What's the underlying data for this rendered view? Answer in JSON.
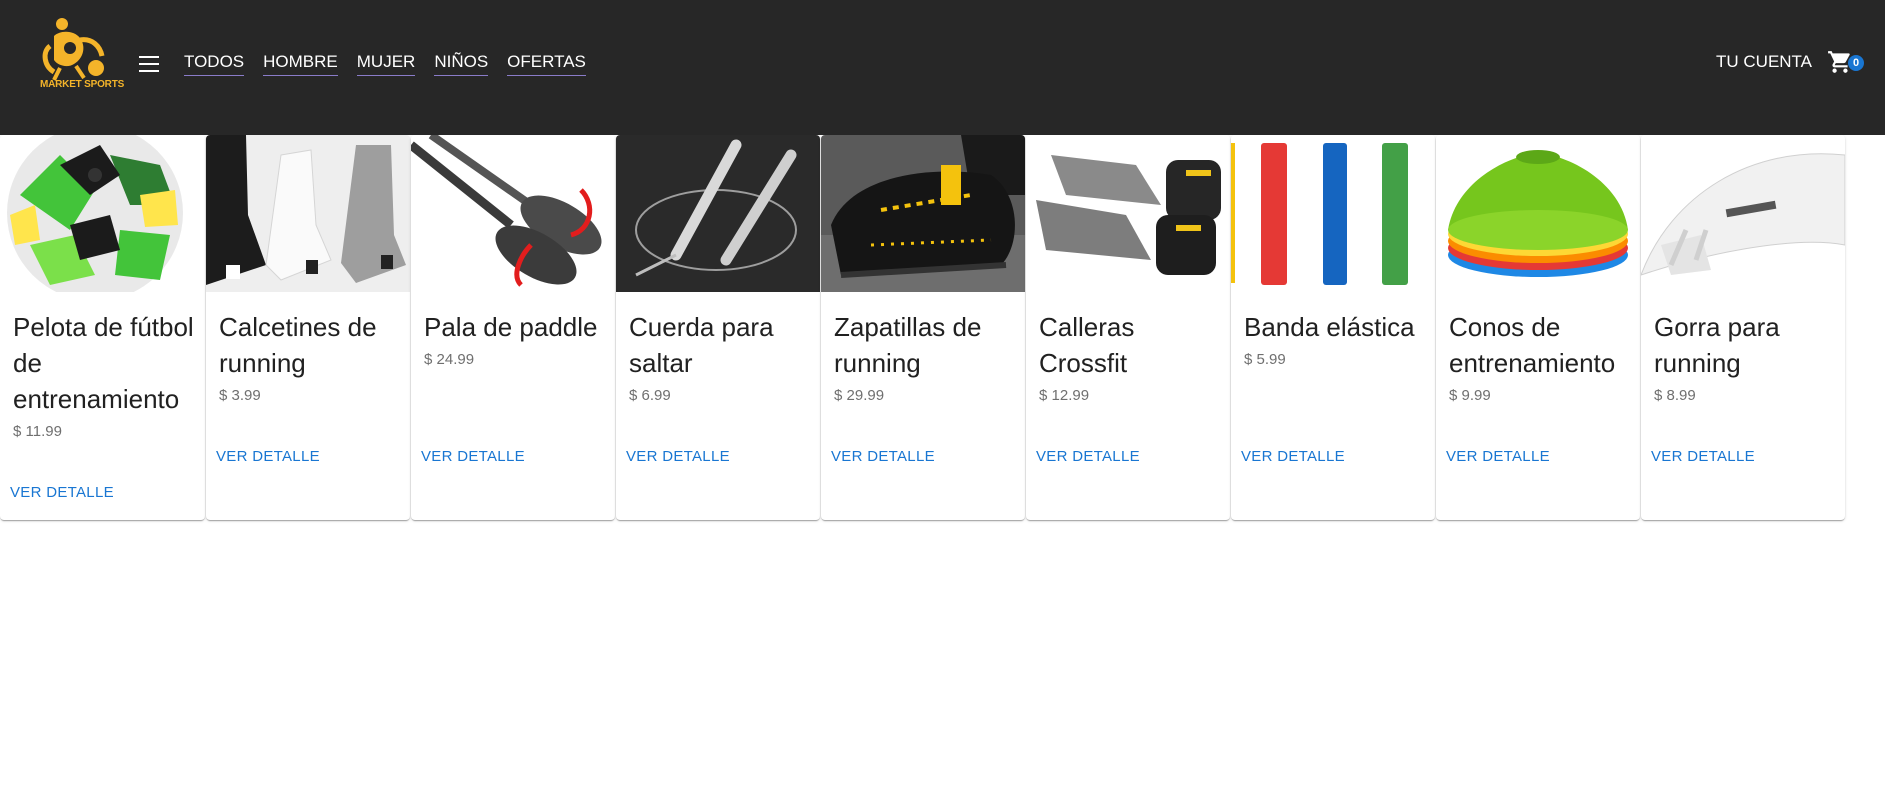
{
  "brand": {
    "name": "MARKET SPORTS"
  },
  "nav": {
    "items": [
      {
        "label": "TODOS"
      },
      {
        "label": "HOMBRE"
      },
      {
        "label": "MUJER"
      },
      {
        "label": "NIÑOS"
      },
      {
        "label": "OFERTAS"
      }
    ]
  },
  "header": {
    "account_label": "TU CUENTA",
    "cart_count": "0"
  },
  "products": [
    {
      "name": "Pelota de fútbol de entrenamiento",
      "price": "$ 11.99",
      "cta": "VER DETALLE"
    },
    {
      "name": "Calcetines de running",
      "price": "$ 3.99",
      "cta": "VER DETALLE"
    },
    {
      "name": "Pala de paddle",
      "price": "$ 24.99",
      "cta": "VER DETALLE"
    },
    {
      "name": "Cuerda para saltar",
      "price": "$ 6.99",
      "cta": "VER DETALLE"
    },
    {
      "name": "Zapatillas de running",
      "price": "$ 29.99",
      "cta": "VER DETALLE"
    },
    {
      "name": "Calleras Crossfit",
      "price": "$ 12.99",
      "cta": "VER DETALLE"
    },
    {
      "name": "Banda elástica",
      "price": "$ 5.99",
      "cta": "VER DETALLE"
    },
    {
      "name": "Conos de entrenamiento",
      "price": "$ 9.99",
      "cta": "VER DETALLE"
    },
    {
      "name": "Gorra para running",
      "price": "$ 8.99",
      "cta": "VER DETALLE"
    }
  ],
  "colors": {
    "appbar": "#272727",
    "accent": "#1976d2",
    "brand": "#f4b42a"
  }
}
